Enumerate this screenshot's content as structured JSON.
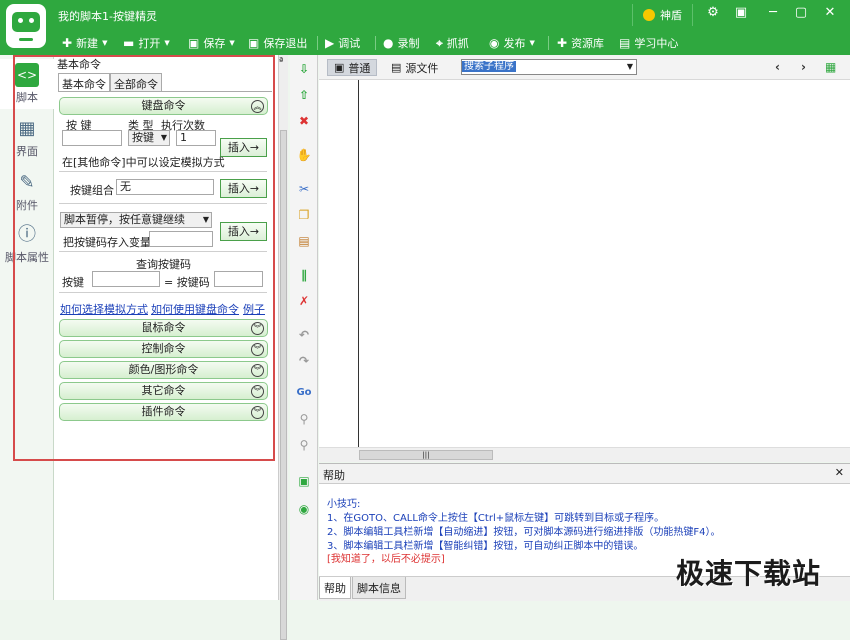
{
  "app": {
    "title": "我的脚本1-按键精灵",
    "badge": "神盾",
    "colors": {
      "brand": "#2fa83f",
      "link": "#1a3fb8",
      "annotation": "#d64b4b"
    }
  },
  "toolbar": {
    "new": "新建",
    "open": "打开",
    "save": "保存",
    "save_exit": "保存退出",
    "debug": "调试",
    "record": "录制",
    "capture": "抓抓",
    "publish": "发布",
    "library": "资源库",
    "learn": "学习中心"
  },
  "sidebar": {
    "items": [
      {
        "label": "脚本",
        "icon": "script-icon"
      },
      {
        "label": "界面",
        "icon": "interface-icon"
      },
      {
        "label": "附件",
        "icon": "attachment-icon"
      },
      {
        "label": "脚本属性",
        "icon": "info-icon"
      }
    ]
  },
  "panel": {
    "title": "基本命令",
    "tabs": [
      "基本命令",
      "全部命令"
    ],
    "keyboard": {
      "header": "键盘命令",
      "col_key": "按 键",
      "col_type": "类 型",
      "col_times": "执行次数",
      "type_value": "按键",
      "times_value": "1",
      "insert": "插入→",
      "note": "在[其他命令]中可以设定模拟方式",
      "combo_label": "按键组合",
      "combo_value": "无",
      "pause_option": "脚本暂停，按任意键继续",
      "store_label": "把按键码存入变量",
      "query_title": "查询按键码",
      "query_key": "按键",
      "query_code": "= 按键码"
    },
    "links": [
      "如何选择模拟方式",
      "如何使用键盘命令",
      "例子"
    ],
    "groups": [
      "鼠标命令",
      "控制命令",
      "颜色/图形命令",
      "其它命令",
      "插件命令"
    ]
  },
  "editor": {
    "tab_normal": "普通",
    "tab_source": "源文件",
    "search_placeholder": "搜索子程序"
  },
  "help": {
    "title": "帮助",
    "lines": [
      "小技巧:",
      "1、在GOTO、CALL命令上按住【Ctrl+鼠标左键】可跳转到目标或子程序。",
      "2、脚本编辑工具栏新增【自动缩进】按钮，可对脚本源码进行缩进排版（功能热键F4）。",
      "3、脚本编辑工具栏新增【智能纠错】按钮，可自动纠正脚本中的错误。"
    ],
    "dismiss": "[我知道了，以后不必提示]",
    "tabs": [
      "帮助",
      "脚本信息"
    ]
  },
  "watermark": "极速下载站"
}
